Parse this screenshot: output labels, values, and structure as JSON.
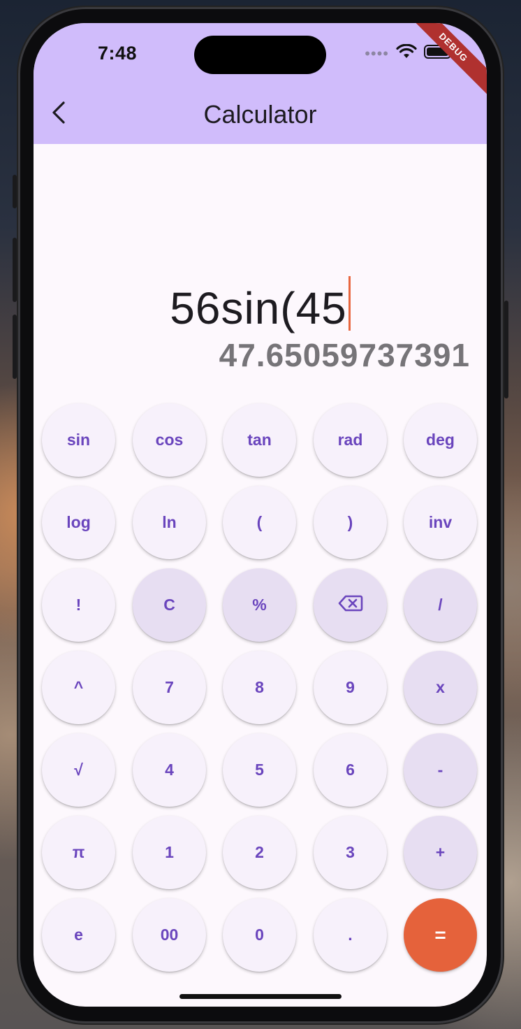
{
  "status_bar": {
    "time": "7:48",
    "signal_dots": "••••",
    "debug_label": "DEBUG"
  },
  "app_bar": {
    "title": "Calculator",
    "back_icon": "chevron-left-icon"
  },
  "display": {
    "expression": "56sin(45",
    "result": "47.65059737391"
  },
  "keypad": {
    "rows": [
      [
        {
          "label": "sin",
          "name": "sin-key",
          "style": "light"
        },
        {
          "label": "cos",
          "name": "cos-key",
          "style": "light"
        },
        {
          "label": "tan",
          "name": "tan-key",
          "style": "light"
        },
        {
          "label": "rad",
          "name": "rad-key",
          "style": "light"
        },
        {
          "label": "deg",
          "name": "deg-key",
          "style": "light"
        }
      ],
      [
        {
          "label": "log",
          "name": "log-key",
          "style": "light"
        },
        {
          "label": "ln",
          "name": "ln-key",
          "style": "light"
        },
        {
          "label": "(",
          "name": "open-paren-key",
          "style": "light"
        },
        {
          "label": ")",
          "name": "close-paren-key",
          "style": "light"
        },
        {
          "label": "inv",
          "name": "inv-key",
          "style": "light"
        }
      ],
      [
        {
          "label": "!",
          "name": "factorial-key",
          "style": "light"
        },
        {
          "label": "C",
          "name": "clear-key",
          "style": "dark"
        },
        {
          "label": "%",
          "name": "percent-key",
          "style": "dark"
        },
        {
          "label": "",
          "name": "backspace-key",
          "style": "dark",
          "icon": "backspace-icon"
        },
        {
          "label": "/",
          "name": "divide-key",
          "style": "dark"
        }
      ],
      [
        {
          "label": "^",
          "name": "power-key",
          "style": "light"
        },
        {
          "label": "7",
          "name": "digit-7-key",
          "style": "light"
        },
        {
          "label": "8",
          "name": "digit-8-key",
          "style": "light"
        },
        {
          "label": "9",
          "name": "digit-9-key",
          "style": "light"
        },
        {
          "label": "x",
          "name": "multiply-key",
          "style": "dark"
        }
      ],
      [
        {
          "label": "√",
          "name": "sqrt-key",
          "style": "light"
        },
        {
          "label": "4",
          "name": "digit-4-key",
          "style": "light"
        },
        {
          "label": "5",
          "name": "digit-5-key",
          "style": "light"
        },
        {
          "label": "6",
          "name": "digit-6-key",
          "style": "light"
        },
        {
          "label": "-",
          "name": "minus-key",
          "style": "dark"
        }
      ],
      [
        {
          "label": "π",
          "name": "pi-key",
          "style": "light"
        },
        {
          "label": "1",
          "name": "digit-1-key",
          "style": "light"
        },
        {
          "label": "2",
          "name": "digit-2-key",
          "style": "light"
        },
        {
          "label": "3",
          "name": "digit-3-key",
          "style": "light"
        },
        {
          "label": "+",
          "name": "plus-key",
          "style": "dark"
        }
      ],
      [
        {
          "label": "e",
          "name": "e-key",
          "style": "light"
        },
        {
          "label": "00",
          "name": "double-zero-key",
          "style": "light"
        },
        {
          "label": "0",
          "name": "digit-0-key",
          "style": "light"
        },
        {
          "label": ".",
          "name": "decimal-key",
          "style": "light"
        },
        {
          "label": "=",
          "name": "equals-key",
          "style": "accent"
        }
      ]
    ]
  },
  "colors": {
    "app_bar": "#d0bcfb",
    "key_text": "#6a45bd",
    "key_light": "#f7f1fb",
    "key_dark": "#e7def2",
    "equals": "#e5623b",
    "caret": "#e8663f",
    "result_text": "#767478"
  }
}
